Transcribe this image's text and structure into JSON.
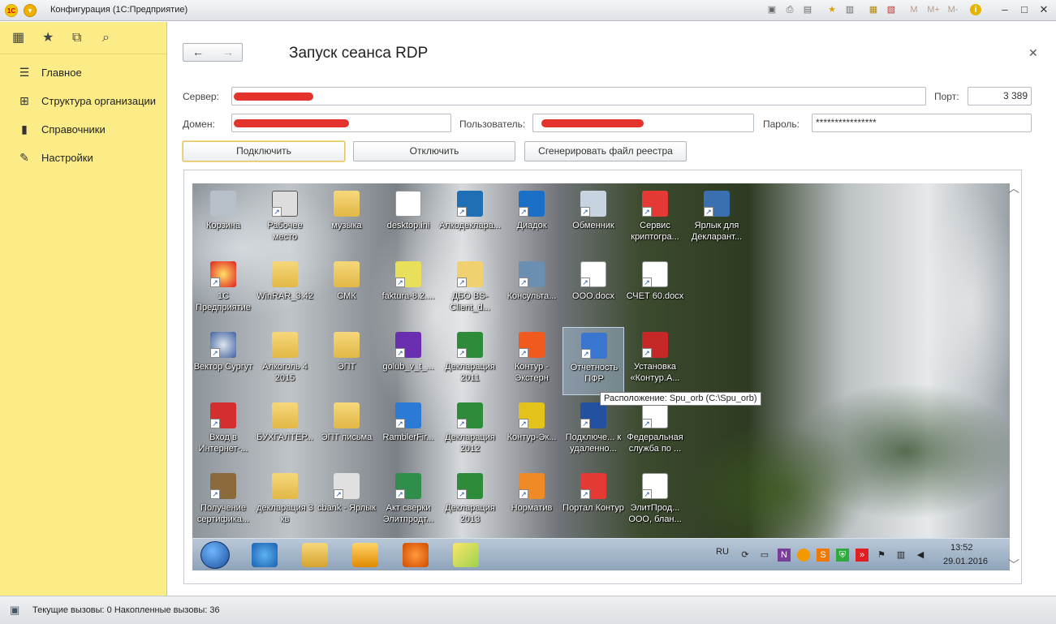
{
  "window": {
    "title": "Конфигурация (1С:Предприятие)"
  },
  "titlebar_icons": {
    "m": "M",
    "mplus": "M+",
    "mminus": "M-",
    "info": "i"
  },
  "sidebar": {
    "items": [
      {
        "label": "Главное",
        "icon": "menu-icon"
      },
      {
        "label": "Структура организации",
        "icon": "org-structure-icon"
      },
      {
        "label": "Справочники",
        "icon": "books-icon"
      },
      {
        "label": "Настройки",
        "icon": "wrench-icon"
      }
    ]
  },
  "form": {
    "title": "Запуск сеанса RDP",
    "server_label": "Сервер:",
    "port_label": "Порт:",
    "port_value": "3 389",
    "domain_label": "Домен:",
    "user_label": "Пользователь:",
    "password_label": "Пароль:",
    "password_value": "****************",
    "connect_label": "Подключить",
    "disconnect_label": "Отключить",
    "generate_label": "Сгенерировать файл реестра"
  },
  "remote_desktop": {
    "icons": [
      {
        "label": "Корзина"
      },
      {
        "label": "Рабочее место"
      },
      {
        "label": "музыка"
      },
      {
        "label": "desktop.ini"
      },
      {
        "label": "Алкодеклара..."
      },
      {
        "label": "Диадок"
      },
      {
        "label": "Обменник"
      },
      {
        "label": "Сервис криптогра..."
      },
      {
        "label": "Ярлык для Декларант..."
      },
      {
        "label": "1С Предприятие"
      },
      {
        "label": "WinRAR_3.42"
      },
      {
        "label": "СМК"
      },
      {
        "label": "faktura-8.2...."
      },
      {
        "label": "ДБО BS-Client_d..."
      },
      {
        "label": "Консульта..."
      },
      {
        "label": "ООО.docx"
      },
      {
        "label": "СЧЕТ 60.docx"
      },
      {
        "label": "Вектор Сургут"
      },
      {
        "label": "Алкоголь 4 2015"
      },
      {
        "label": "ЭПТ"
      },
      {
        "label": "golub_v_t_..."
      },
      {
        "label": "Декларация 2011"
      },
      {
        "label": "Контур - Экстерн"
      },
      {
        "label": "Отчетность ПФР"
      },
      {
        "label": "Установка «Контур.А..."
      },
      {
        "label": "Вход в Интернет-..."
      },
      {
        "label": "БУХГАЛТЕР..."
      },
      {
        "label": "ЭПТ письма"
      },
      {
        "label": "RamblerFir..."
      },
      {
        "label": "Декларация 2012"
      },
      {
        "label": "Контур-Эк..."
      },
      {
        "label": "Подключе... к удаленно..."
      },
      {
        "label": "Федеральная служба по ..."
      },
      {
        "label": "Получение сертифика..."
      },
      {
        "label": "декларация 3 кв"
      },
      {
        "label": "cbank - Ярлык"
      },
      {
        "label": "Акт сверки Элитпродт..."
      },
      {
        "label": "Декларация 2013"
      },
      {
        "label": "Норматив"
      },
      {
        "label": "Портал Контур"
      },
      {
        "label": "ЭлитПрод... ООО, блан..."
      }
    ],
    "tooltip": "Расположение: Spu_orb (C:\\Spu_orb)",
    "taskbar": {
      "lang": "RU",
      "time": "13:52",
      "date": "29.01.2016"
    }
  },
  "status": {
    "text": "Текущие вызовы: 0   Накопленные вызовы: 36"
  }
}
